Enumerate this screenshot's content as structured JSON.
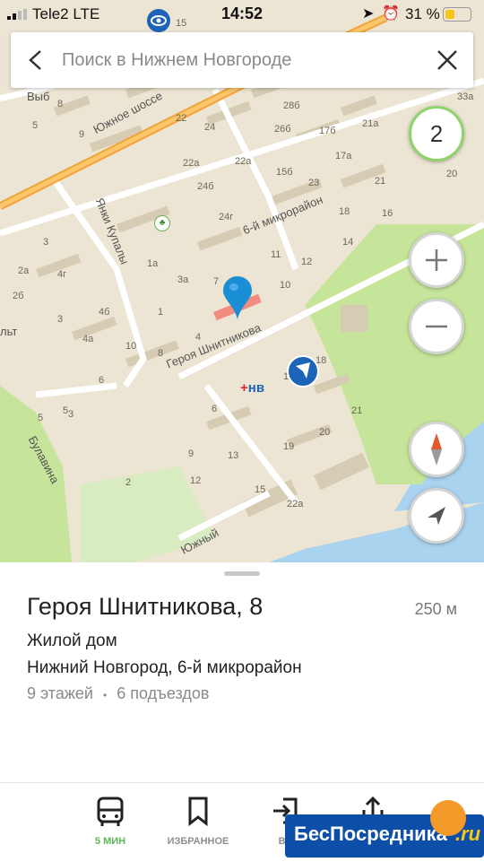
{
  "status_bar": {
    "carrier": "Tele2  LTE",
    "time": "14:52",
    "battery_percent": "31 %"
  },
  "search": {
    "placeholder": "Поиск в Нижнем Новгороде"
  },
  "map": {
    "cluster_count": "2",
    "labels": {
      "road_south": "Южное шоссе",
      "road_kupaly": "Янки Купалы",
      "road_6mkr": "6-й микрорайон",
      "road_shnitnikova": "Героя Шнитникова",
      "road_bulavina": "Булавина",
      "road_yuzhny": "Южный",
      "road_vyb": "Выб",
      "road_lt": "льт"
    },
    "house_numbers": [
      "15",
      "26",
      "28б",
      "21а",
      "33а",
      "8",
      "5",
      "9",
      "22",
      "26б",
      "17б",
      "19",
      "24",
      "22а",
      "22а",
      "15б",
      "17а",
      "20",
      "24б",
      "23",
      "21",
      "18",
      "24г",
      "16",
      "3",
      "2а",
      "14",
      "4г",
      "1а",
      "11",
      "12",
      "2б",
      "3а",
      "7",
      "10",
      "4б",
      "1",
      "3",
      "4а",
      "10",
      "8",
      "4",
      "6",
      "1",
      "18",
      "5",
      "21",
      "5",
      "3",
      "20",
      "13",
      "19",
      "6",
      "9",
      "12",
      "15",
      "22а",
      "2"
    ],
    "poi_label": "нв"
  },
  "place": {
    "address": "Героя Шнитникова, 8",
    "distance": "250 м",
    "building_type": "Жилой дом",
    "city_district": "Нижний Новгород, 6-й микрорайон",
    "floors": "9 этажей",
    "separator": "•",
    "entrances": "6 подъездов"
  },
  "tabs": [
    {
      "label": "5 МИН",
      "icon": "bus-icon",
      "active": true
    },
    {
      "label": "ИЗБРАННОЕ",
      "icon": "bookmark-icon",
      "active": false
    },
    {
      "label": "ВХ",
      "icon": "login-icon",
      "active": false
    },
    {
      "label": "",
      "icon": "share-icon",
      "active": false
    }
  ],
  "promo": {
    "text": "БесПосредника",
    "suffix": ".ru"
  },
  "colors": {
    "accent_green": "#5cb85c",
    "pin_blue": "#1a8fd6",
    "water": "#aad3ef",
    "park": "#c6e59a",
    "road_orange": "#f2a33a"
  }
}
